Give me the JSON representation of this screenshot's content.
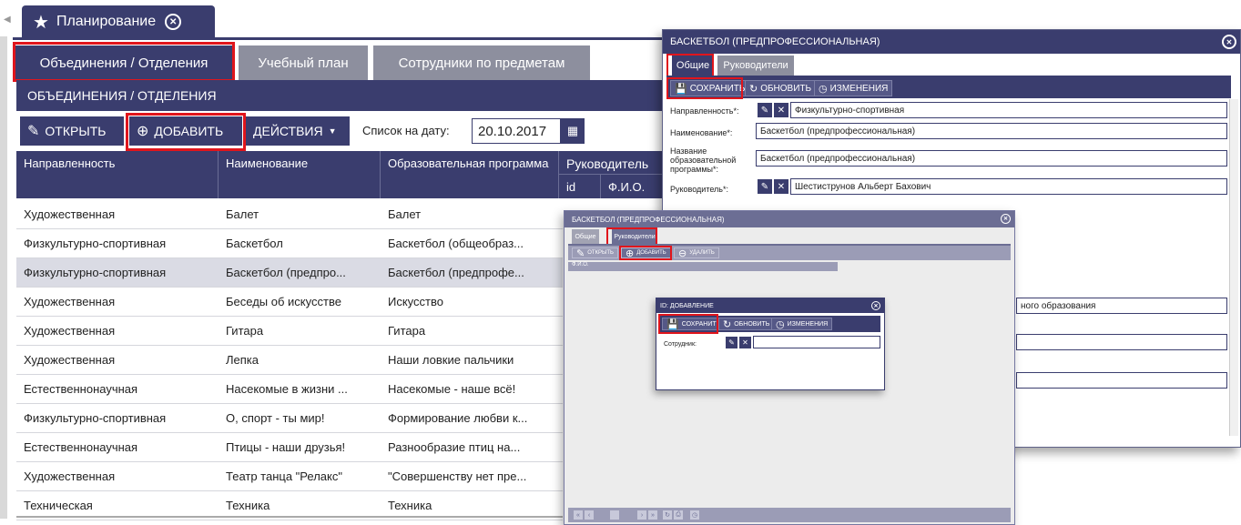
{
  "main": {
    "title": "Планирование",
    "tabs": [
      "Объединения / Отделения",
      "Учебный план",
      "Сотрудники по предметам"
    ],
    "section_title": "ОБЪЕДИНЕНИЯ / ОТДЕЛЕНИЯ",
    "toolbar": {
      "open_label": "ОТКРЫТЬ",
      "add_label": "ДОБАВИТЬ",
      "actions_label": "ДЕЙСТВИЯ",
      "date_label": "Список на дату:",
      "date_value": "20.10.2017"
    },
    "columns": {
      "direction": "Направленность",
      "name": "Наименование",
      "program": "Образовательная программа",
      "leader": "Руководитель",
      "leader_id": "id",
      "leader_fio": "Ф.И.О."
    },
    "rows": [
      {
        "direction": "Художественная",
        "name": "Балет",
        "program": "Балет"
      },
      {
        "direction": "Физкультурно-спортивная",
        "name": "Баскетбол",
        "program": "Баскетбол (общеобраз..."
      },
      {
        "direction": "Физкультурно-спортивная",
        "name": "Баскетбол (предпро...",
        "program": "Баскетбол (предпрофе..."
      },
      {
        "direction": "Художественная",
        "name": "Беседы об искусстве",
        "program": "Искусство"
      },
      {
        "direction": "Художественная",
        "name": "Гитара",
        "program": "Гитара"
      },
      {
        "direction": "Художественная",
        "name": "Лепка",
        "program": "Наши ловкие пальчики"
      },
      {
        "direction": "Естественнонаучная",
        "name": "Насекомые в жизни ...",
        "program": "Насекомые - наше всё!"
      },
      {
        "direction": "Физкультурно-спортивная",
        "name": "О, спорт - ты мир!",
        "program": "Формирование любви к..."
      },
      {
        "direction": "Естественнонаучная",
        "name": "Птицы - наши друзья!",
        "program": "Разнообразие птиц на..."
      },
      {
        "direction": "Художественная",
        "name": "Театр танца \"Релакс\"",
        "program": "\"Совершенству нет пре..."
      },
      {
        "direction": "Техническая",
        "name": "Техника",
        "program": "Техника"
      }
    ],
    "selected_row": 2
  },
  "dialog1": {
    "title": "БАСКЕТБОЛ (ПРЕДПРОФЕССИОНАЛЬНАЯ)",
    "tabs": [
      "Общие",
      "Руководители"
    ],
    "toolbar": {
      "save": "СОХРАНИТЬ",
      "refresh": "ОБНОВИТЬ",
      "changes": "ИЗМЕНЕНИЯ"
    },
    "fields": {
      "direction_label": "Направленность*:",
      "direction_value": "Физкультурно-спортивная",
      "name_label": "Наименование*:",
      "name_value": "Баскетбол (предпрофессиональная)",
      "program_label": "Название образовательной программы*:",
      "program_value": "Баскетбол (предпрофессиональная)",
      "leader_label": "Руководитель*:",
      "leader_value": "Шестиструнов Альберт Бахович",
      "extra_value": "ного образования"
    }
  },
  "dialog2": {
    "title": "БАСКЕТБОЛ (ПРЕДПРОФЕССИОНАЛЬНАЯ)",
    "tabs": [
      "Общие",
      "Руководители"
    ],
    "toolbar": {
      "open": "ОТКРЫТЬ",
      "add": "ДОБАВИТЬ",
      "delete": "УДАЛИТЬ"
    },
    "column": "Ф.И.О."
  },
  "dialog3": {
    "title": "ID: ДОБАВЛЕНИЕ",
    "toolbar": {
      "save": "СОХРАНИТЬ",
      "refresh": "ОБНОВИТЬ",
      "changes": "ИЗМЕНЕНИЯ"
    },
    "employee_label": "Сотрудник:"
  },
  "colors": {
    "primary": "#3a3d6e",
    "highlight": "#e0151c",
    "tab_inactive": "#8d8f9e"
  }
}
